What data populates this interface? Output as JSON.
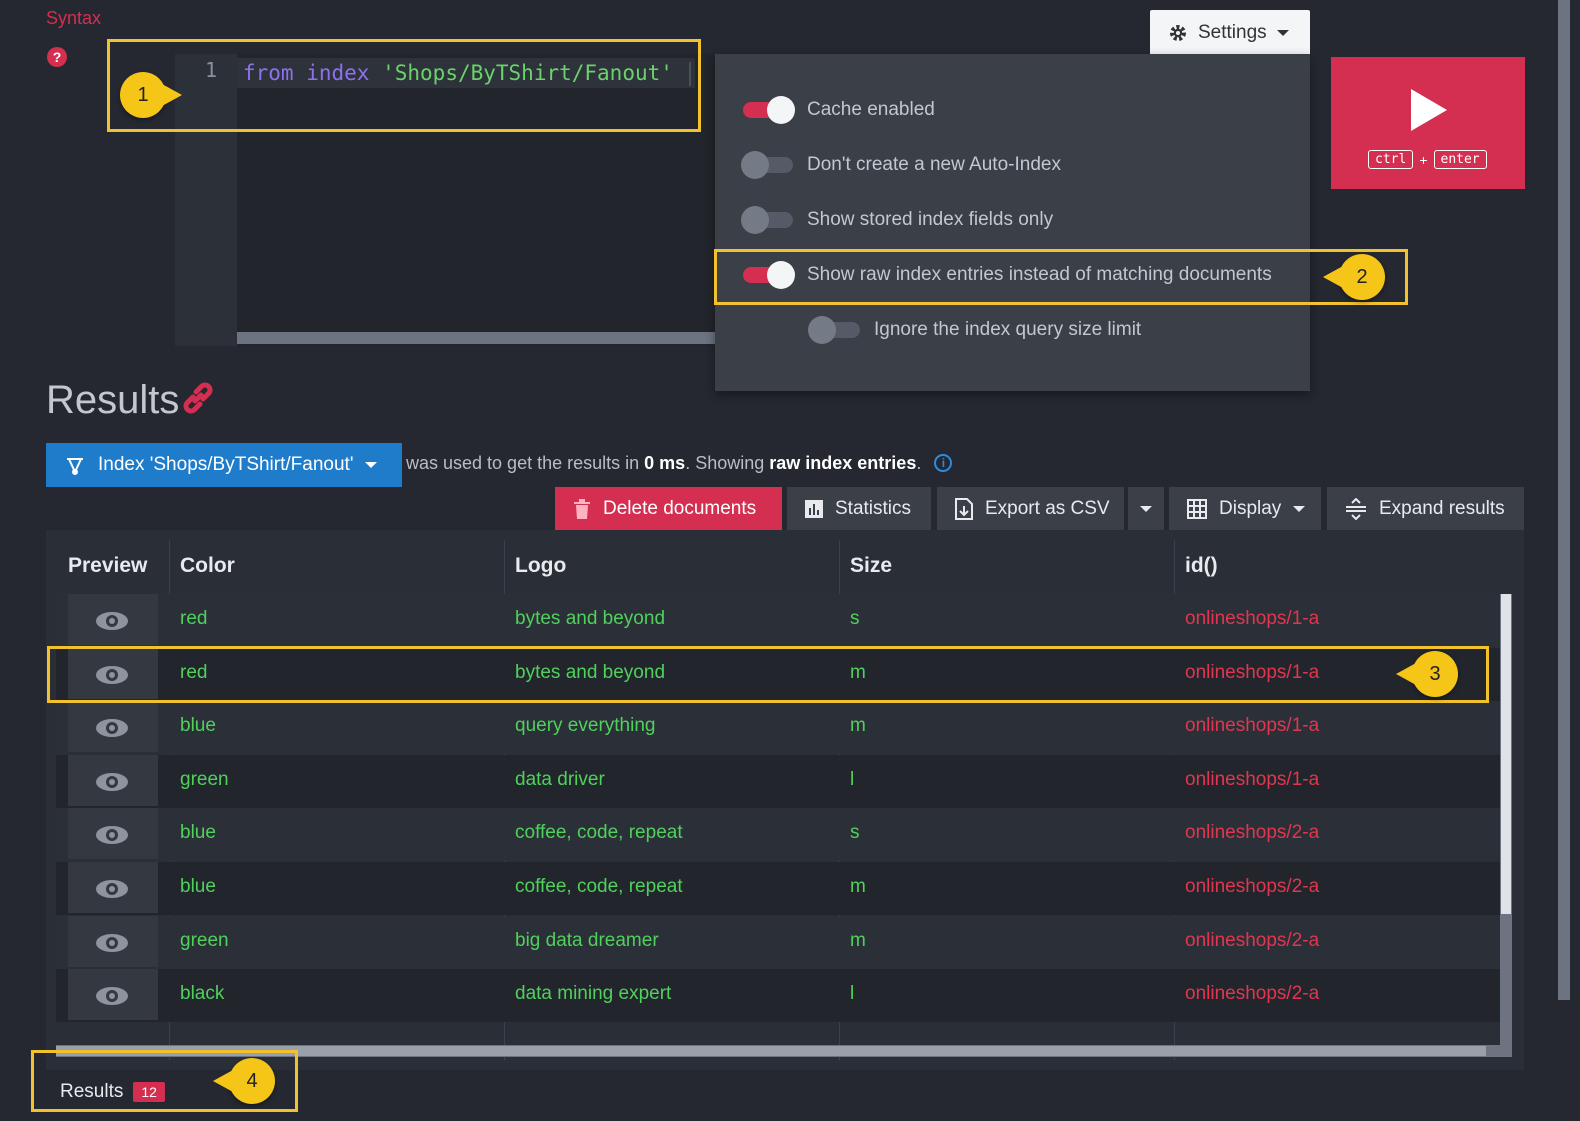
{
  "query": {
    "syntax_label": "Syntax",
    "help_glyph": "?",
    "line_number": "1",
    "code_kw1": "from",
    "code_kw2": "index",
    "code_str": "'Shops/ByTShirt/Fanout'"
  },
  "settings": {
    "button_label": "Settings",
    "options": [
      {
        "label": "Cache enabled",
        "on": true
      },
      {
        "label": "Don't create a new Auto-Index",
        "on": false
      },
      {
        "label": "Show stored index fields only",
        "on": false
      },
      {
        "label": "Show raw index entries instead of matching documents",
        "on": true
      },
      {
        "label": "Ignore the index query size limit",
        "on": false
      }
    ]
  },
  "run": {
    "key1": "ctrl",
    "plus": "+",
    "key2": "enter"
  },
  "results": {
    "title": "Results",
    "index_button": "Index 'Shops/ByTShirt/Fanout'",
    "used_prefix": "was used to get the results in",
    "duration": "0 ms",
    "showing_prefix": ". Showing",
    "showing_value": "raw index entries",
    "showing_suffix": ".",
    "info_glyph": "i"
  },
  "toolbar": {
    "delete": "Delete documents",
    "statistics": "Statistics",
    "export": "Export as CSV",
    "display": "Display",
    "expand": "Expand results"
  },
  "table": {
    "headers": [
      "Preview",
      "Color",
      "Logo",
      "Size",
      "id()"
    ],
    "rows": [
      [
        "red",
        "bytes and beyond",
        "s",
        "onlineshops/1-a"
      ],
      [
        "red",
        "bytes and beyond",
        "m",
        "onlineshops/1-a"
      ],
      [
        "blue",
        "query everything",
        "m",
        "onlineshops/1-a"
      ],
      [
        "green",
        "data driver",
        "l",
        "onlineshops/1-a"
      ],
      [
        "blue",
        "coffee, code, repeat",
        "s",
        "onlineshops/2-a"
      ],
      [
        "blue",
        "coffee, code, repeat",
        "m",
        "onlineshops/2-a"
      ],
      [
        "green",
        "big data dreamer",
        "m",
        "onlineshops/2-a"
      ],
      [
        "black",
        "data mining expert",
        "l",
        "onlineshops/2-a"
      ]
    ]
  },
  "tabs": {
    "results_label": "Results",
    "results_count": "12"
  },
  "callouts": [
    "1",
    "2",
    "3",
    "4"
  ],
  "colors": {
    "accent": "#d42f51",
    "primary": "#1f7ccb",
    "highlight": "#f2c12e",
    "value_green": "#4fd15c"
  }
}
